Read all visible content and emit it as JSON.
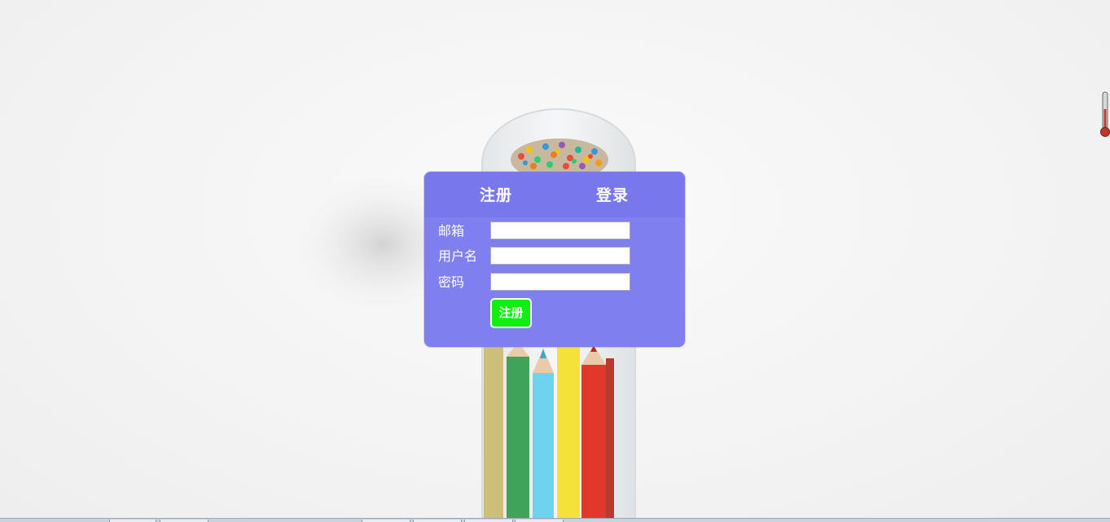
{
  "tabs": {
    "register": "注册",
    "login": "登录"
  },
  "form": {
    "email_label": "邮箱",
    "username_label": "用户名",
    "password_label": "密码",
    "email_value": "",
    "username_value": "",
    "password_value": "",
    "submit_label": "注册"
  },
  "colors": {
    "card_background": "#7f7fef",
    "tab_bar": "#7878ec",
    "submit_button": "#11ee11",
    "text": "#ffffff"
  },
  "icons": {
    "background": "pencils-and-sprinkles-image",
    "widget": "thermometer-icon"
  }
}
